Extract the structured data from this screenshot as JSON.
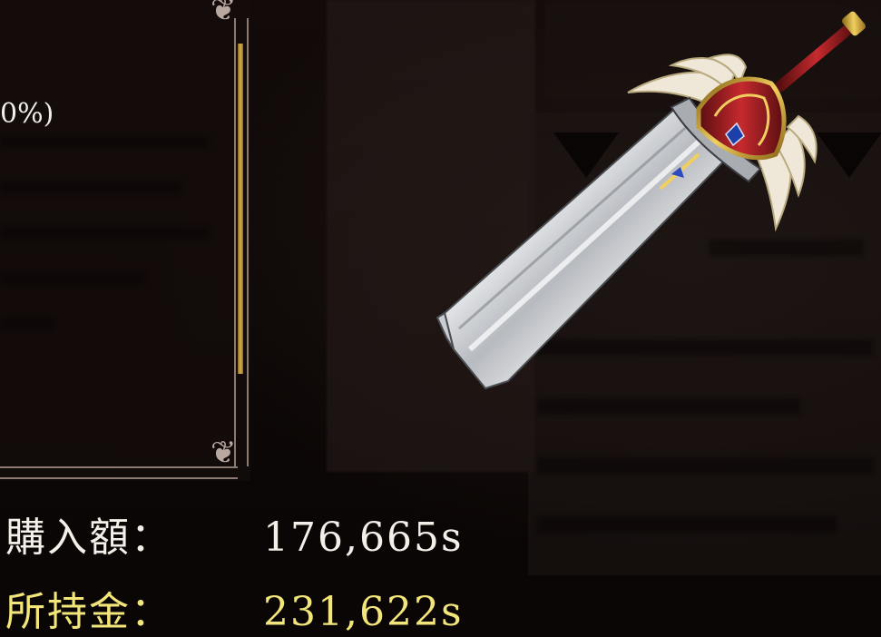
{
  "info_panel": {
    "visible_text": "0%)"
  },
  "price": {
    "purchase_label": "購入額：",
    "purchase_value": "176,665s",
    "owned_label": "所持金：",
    "owned_value": "231,622s"
  },
  "colors": {
    "purchase_text": "#f3efe9",
    "owned_text": "#f2e57a",
    "frame": "#8a7a72",
    "scroll_thumb": "#d9b04a"
  },
  "icons": {
    "item_preview": "greatsword-icon",
    "frame_corner": "ornament-icon"
  }
}
